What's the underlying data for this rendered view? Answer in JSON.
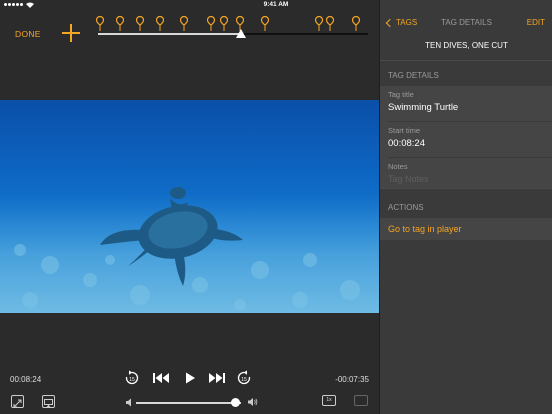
{
  "status_bar": {
    "carrier": "",
    "time": "9:41 AM",
    "battery": ""
  },
  "player": {
    "done_label": "DONE",
    "elapsed": "00:08:24",
    "remaining": "-00:07:35",
    "progress_fraction": 0.53,
    "volume_fraction": 0.9,
    "rate_label": "1x",
    "tag_marker_count": 13
  },
  "sidebar": {
    "back_label": "TAGS",
    "nav_title": "TAG DETAILS",
    "edit_label": "EDIT",
    "subtitle": "TEN DIVES, ONE CUT",
    "details_header": "TAG DETAILS",
    "fields": [
      {
        "label": "Tag title",
        "value": "Swimming Turtle"
      },
      {
        "label": "Start time",
        "value": "00:08:24"
      },
      {
        "label": "Notes",
        "placeholder": "Tag Notes"
      }
    ],
    "actions_header": "ACTIONS",
    "action_label": "Go to tag in player"
  },
  "colors": {
    "accent": "#f5a623",
    "panel": "#3a3a3a",
    "background": "#2b2b2b"
  },
  "icons": [
    "wifi-icon",
    "plus-icon",
    "tag-pin-icon",
    "rewind-icon",
    "skip-back-icon",
    "play-icon",
    "skip-forward-icon",
    "forward-icon",
    "fullscreen-icon",
    "airplay-icon",
    "volume-low-icon",
    "volume-high-icon",
    "captions-icon",
    "back-chevron-icon"
  ]
}
